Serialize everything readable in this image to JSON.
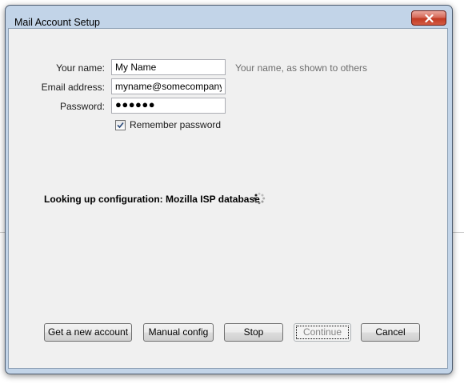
{
  "window": {
    "title": "Mail Account Setup"
  },
  "form": {
    "name_label": "Your name:",
    "name_value": "My Name",
    "name_hint": "Your name, as shown to others",
    "email_label": "Email address:",
    "email_value": "myname@somecompany",
    "password_label": "Password:",
    "password_value": "●●●●●●",
    "remember_label": "Remember password",
    "remember_checked": true
  },
  "status": {
    "text": "Looking up configuration: Mozilla ISP database"
  },
  "buttons": {
    "new_account": "Get a new account",
    "manual_config": "Manual config",
    "stop": "Stop",
    "continue": "Continue",
    "cancel": "Cancel"
  },
  "icons": {
    "close": "close-icon",
    "spinner": "loading-spinner-icon",
    "check": "checkmark-icon"
  },
  "colors": {
    "close_button": "#c23a22",
    "window_frame": "#c2d4e8",
    "dialog_bg": "#f0f0f0",
    "hint_text": "#6d6d6d"
  }
}
